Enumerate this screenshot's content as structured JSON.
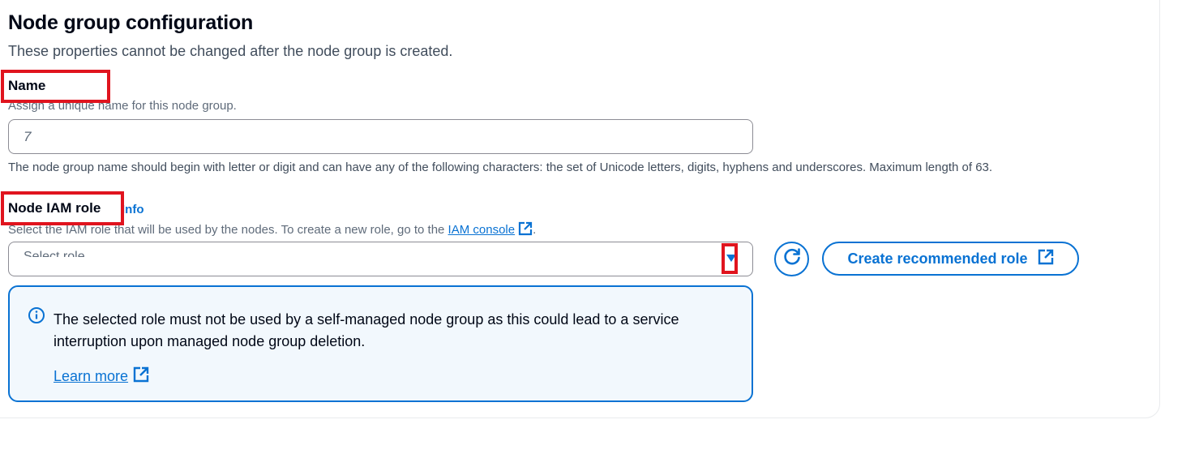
{
  "section": {
    "title": "Node group configuration",
    "subtitle": "These properties cannot be changed after the node group is created."
  },
  "name_field": {
    "label": "Name",
    "description": "Assign a unique name for this node group.",
    "value": "7",
    "constraint": "The node group name should begin with letter or digit and can have any of the following characters: the set of Unicode letters, digits, hyphens and underscores. Maximum length of 63."
  },
  "iam_role_field": {
    "label": "Node IAM role",
    "info_link": "Info",
    "description_prefix": "Select the IAM role that will be used by the nodes. To create a new role, go to the ",
    "console_link": "IAM console",
    "description_suffix": ".",
    "selected_value": "Select role",
    "refresh_icon": "refresh-icon",
    "create_button": "Create recommended role"
  },
  "alert": {
    "icon": "info-icon",
    "message": "The selected role must not be used by a self-managed node group as this could lead to a service interruption upon managed node group deletion.",
    "learn_more": "Learn more"
  },
  "colors": {
    "accent": "#0972d3",
    "highlight": "#e0141e",
    "alert_bg": "#f2f8fd"
  }
}
